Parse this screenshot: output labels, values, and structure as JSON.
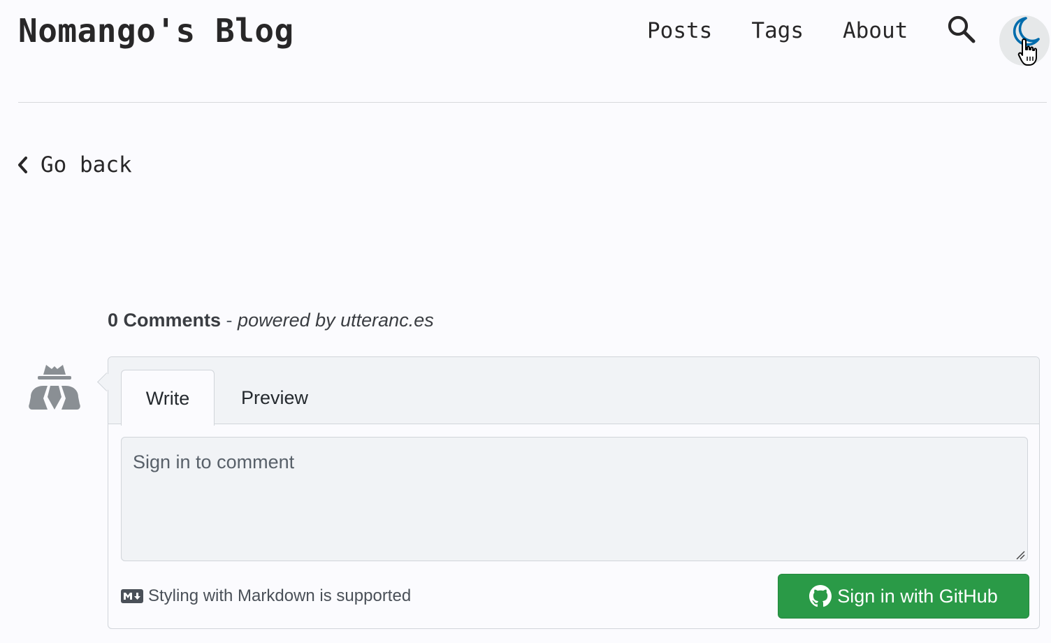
{
  "header": {
    "site_title": "Nomango's Blog",
    "nav": [
      {
        "label": "Posts"
      },
      {
        "label": "Tags"
      },
      {
        "label": "About"
      }
    ],
    "search_icon": "search-icon",
    "theme_icon": "moon-icon"
  },
  "go_back": {
    "label": "Go back",
    "icon": "chevron-left-icon"
  },
  "comments": {
    "count_label": "0 Comments",
    "separator": " - ",
    "powered_by": "powered by utteranc.es",
    "avatar_icon": "anonymous-user-icon",
    "tabs": [
      {
        "label": "Write",
        "active": true
      },
      {
        "label": "Preview",
        "active": false
      }
    ],
    "textarea_placeholder": "Sign in to comment",
    "markdown_hint": "Styling with Markdown is supported",
    "markdown_icon": "markdown-icon",
    "signin_button": "Sign in with GitHub",
    "github_icon": "github-icon"
  },
  "colors": {
    "background": "#fbfbfe",
    "text": "#282728",
    "accent": "#006cac",
    "button_green": "#2a9a47"
  }
}
